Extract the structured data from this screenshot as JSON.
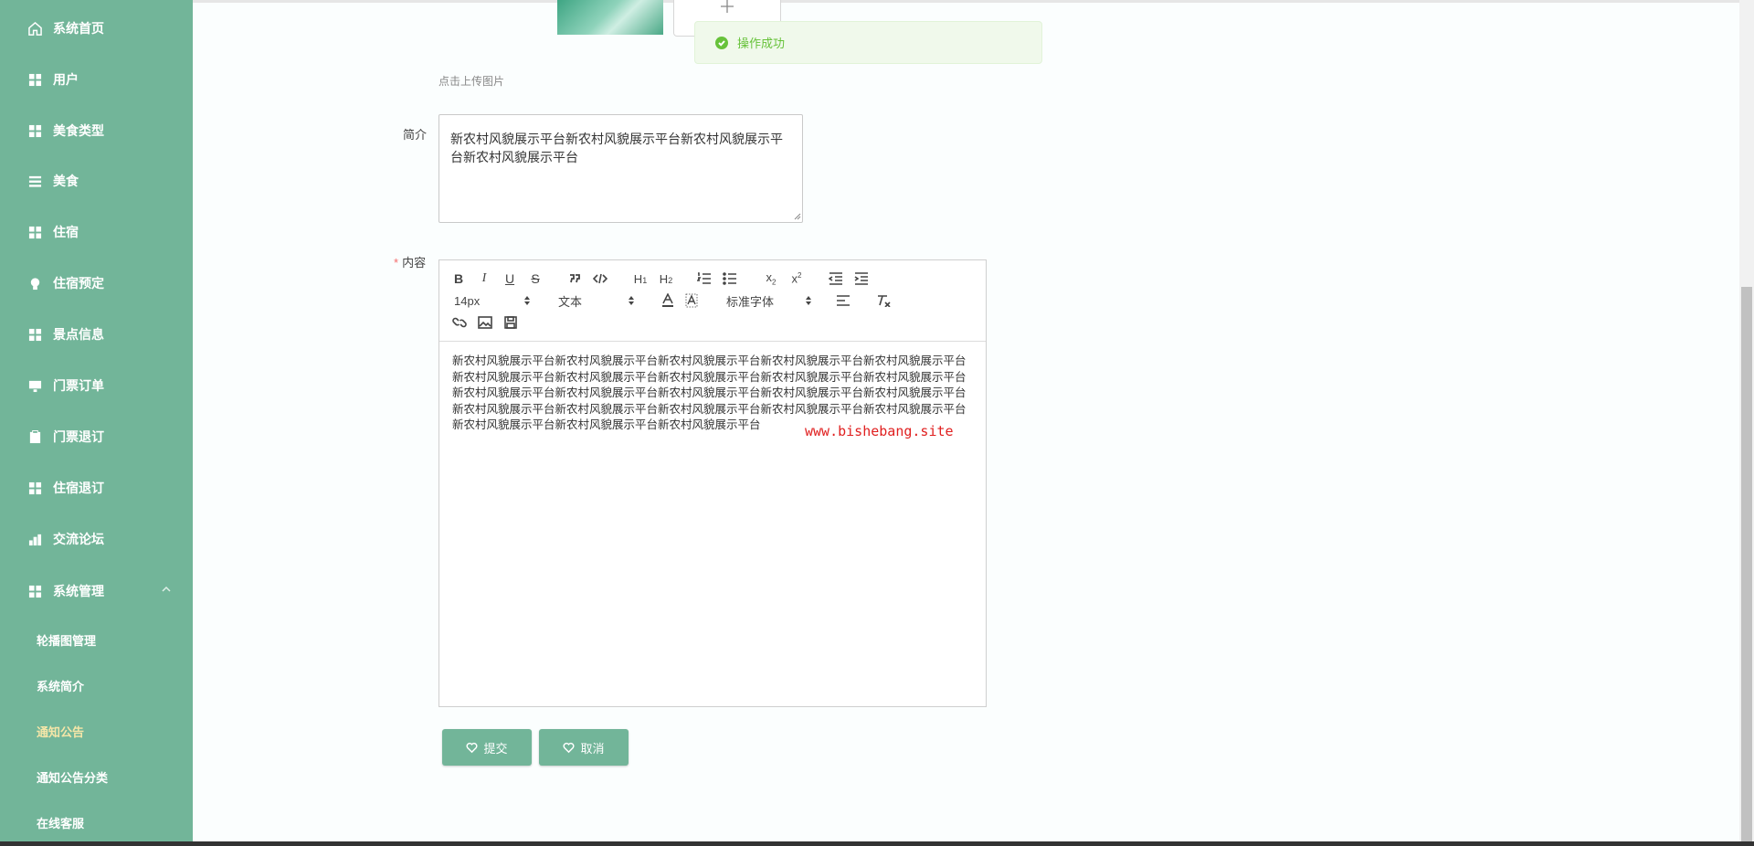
{
  "sidebar": {
    "items": [
      {
        "label": "系统首页",
        "icon": "home-icon"
      },
      {
        "label": "用户",
        "icon": "grid-icon"
      },
      {
        "label": "美食类型",
        "icon": "grid-icon"
      },
      {
        "label": "美食",
        "icon": "list-icon"
      },
      {
        "label": "住宿",
        "icon": "grid-icon"
      },
      {
        "label": "住宿预定",
        "icon": "bulb-icon"
      },
      {
        "label": "景点信息",
        "icon": "grid-icon"
      },
      {
        "label": "门票订单",
        "icon": "monitor-icon"
      },
      {
        "label": "门票退订",
        "icon": "clipboard-icon"
      },
      {
        "label": "住宿退订",
        "icon": "grid-icon"
      },
      {
        "label": "交流论坛",
        "icon": "chart-icon"
      },
      {
        "label": "系统管理",
        "icon": "grid-icon"
      }
    ],
    "sub_items": [
      {
        "label": "轮播图管理"
      },
      {
        "label": "系统简介"
      },
      {
        "label": "通知公告"
      },
      {
        "label": "通知公告分类"
      },
      {
        "label": "在线客服"
      }
    ],
    "active_color": "#f5e6a8",
    "bg_color": "#72b599"
  },
  "toast": {
    "message": "操作成功",
    "icon": "check-circle-icon"
  },
  "upload": {
    "hint": "点击上传图片",
    "icon": "plus-icon"
  },
  "form": {
    "intro_label": "简介",
    "intro_value": "新农村风貌展示平台新农村风貌展示平台新农村风貌展示平台新农村风貌展示平台",
    "content_label": "内容",
    "required_mark": "*"
  },
  "editor": {
    "font_size": "14px",
    "text_style": "文本",
    "font_family": "标准字体",
    "content": "新农村风貌展示平台新农村风貌展示平台新农村风貌展示平台新农村风貌展示平台新农村风貌展示平台新农村风貌展示平台新农村风貌展示平台新农村风貌展示平台新农村风貌展示平台新农村风貌展示平台新农村风貌展示平台新农村风貌展示平台新农村风貌展示平台新农村风貌展示平台新农村风貌展示平台新农村风貌展示平台新农村风貌展示平台新农村风貌展示平台新农村风貌展示平台新农村风貌展示平台新农村风貌展示平台新农村风貌展示平台新农村风貌展示平台",
    "watermark": "www.bishebang.site"
  },
  "buttons": {
    "submit": "提交",
    "cancel": "取消"
  }
}
